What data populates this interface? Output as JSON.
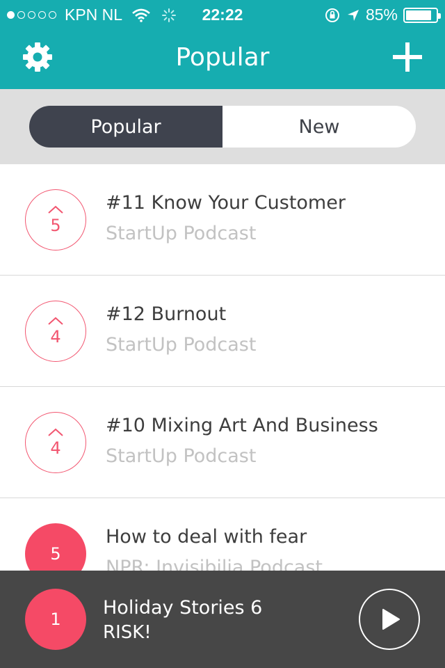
{
  "status_bar": {
    "carrier": "KPN NL",
    "time": "22:22",
    "battery": "85%",
    "battery_level": 0.85,
    "signal_bars": 1,
    "icons": [
      "wifi-icon",
      "activity-spinner-icon",
      "rotation-lock-icon",
      "location-arrow-icon",
      "battery-icon"
    ]
  },
  "navbar": {
    "title": "Popular",
    "left_icon": "gear-icon",
    "right_icon": "plus-icon"
  },
  "segmented": {
    "options": [
      "Popular",
      "New"
    ],
    "selected": "Popular"
  },
  "episodes": [
    {
      "votes": "5",
      "title": "#11 Know Your Customer",
      "podcast": "StartUp Podcast",
      "voted": false
    },
    {
      "votes": "4",
      "title": "#12 Burnout",
      "podcast": "StartUp Podcast",
      "voted": false
    },
    {
      "votes": "4",
      "title": "#10 Mixing Art And Business",
      "podcast": "StartUp Podcast",
      "voted": false
    },
    {
      "votes": "5",
      "title": "How to deal with fear",
      "podcast": "NPR: Invisibilia Podcast",
      "voted": true
    }
  ],
  "player": {
    "badge": "1",
    "title": "Holiday Stories 6",
    "subtitle": "RISK!",
    "icon": "play-icon"
  },
  "colors": {
    "teal": "#16adb0",
    "accent": "#f54a66",
    "dark": "#3f434e",
    "player_bg": "#474747"
  }
}
